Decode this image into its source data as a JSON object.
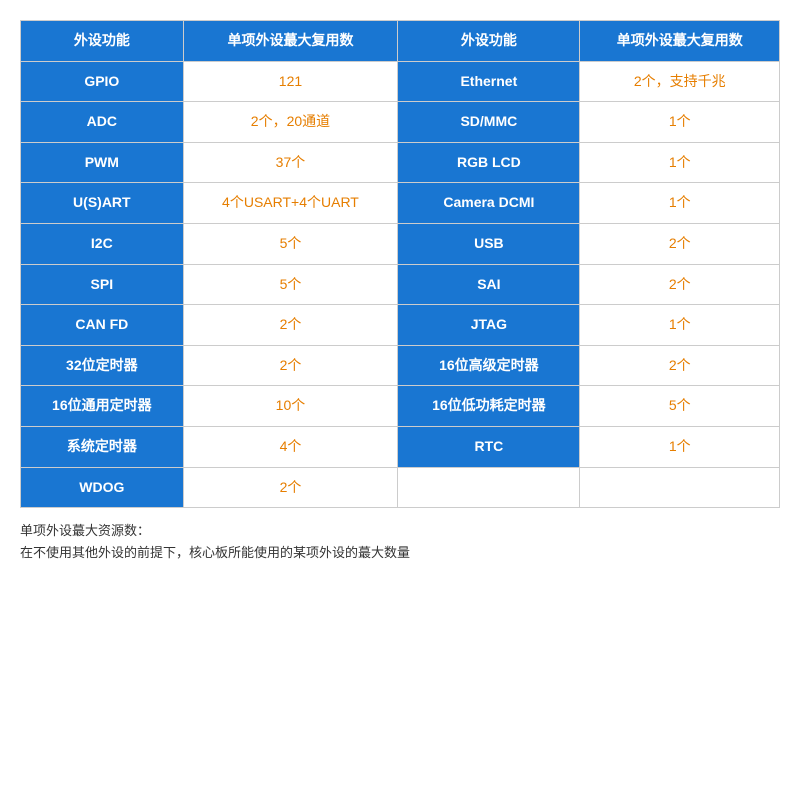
{
  "table": {
    "headers": [
      {
        "label": "外设功能",
        "col": 0
      },
      {
        "label": "单项外设蕞大复用数",
        "col": 1
      },
      {
        "label": "外设功能",
        "col": 2
      },
      {
        "label": "单项外设蕞大复用数",
        "col": 3
      }
    ],
    "rows": [
      {
        "left_name": "GPIO",
        "left_value": "121",
        "right_name": "Ethernet",
        "right_value": "2个，支持千兆"
      },
      {
        "left_name": "ADC",
        "left_value": "2个，20通道",
        "right_name": "SD/MMC",
        "right_value": "1个"
      },
      {
        "left_name": "PWM",
        "left_value": "37个",
        "right_name": "RGB LCD",
        "right_value": "1个"
      },
      {
        "left_name": "U(S)ART",
        "left_value": "4个USART+4个UART",
        "right_name": "Camera DCMI",
        "right_value": "1个"
      },
      {
        "left_name": "I2C",
        "left_value": "5个",
        "right_name": "USB",
        "right_value": "2个"
      },
      {
        "left_name": "SPI",
        "left_value": "5个",
        "right_name": "SAI",
        "right_value": "2个"
      },
      {
        "left_name": "CAN FD",
        "left_value": "2个",
        "right_name": "JTAG",
        "right_value": "1个"
      },
      {
        "left_name": "32位定时器",
        "left_value": "2个",
        "right_name": "16位高级定时器",
        "right_value": "2个"
      },
      {
        "left_name": "16位通用定时器",
        "left_value": "10个",
        "right_name": "16位低功耗定时器",
        "right_value": "5个"
      },
      {
        "left_name": "系统定时器",
        "left_value": "4个",
        "right_name": "RTC",
        "right_value": "1个"
      },
      {
        "left_name": "WDOG",
        "left_value": "2个",
        "right_name": "",
        "right_value": ""
      }
    ],
    "footnote_line1": "单项外设蕞大资源数：",
    "footnote_line2": "在不使用其他外设的前提下，核心板所能使用的某项外设的蕞大数量"
  }
}
